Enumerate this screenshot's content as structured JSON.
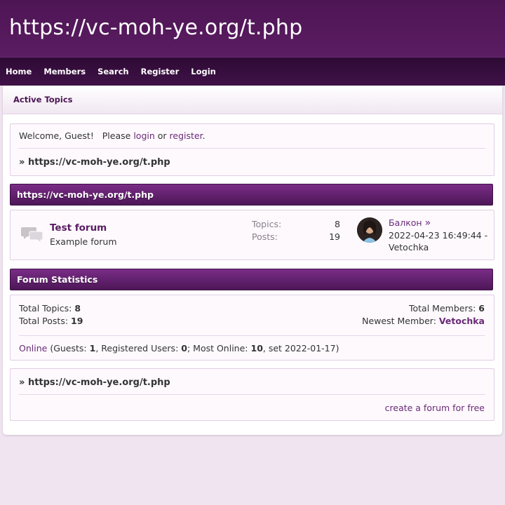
{
  "header": {
    "title": "https://vc-moh-ye.org/t.php"
  },
  "nav": {
    "items": [
      "Home",
      "Members",
      "Search",
      "Register",
      "Login"
    ]
  },
  "subnav": {
    "active_topics": "Active Topics"
  },
  "welcome": {
    "text": "Welcome, Guest!   Please",
    "login": "login",
    "or": "or",
    "register": "register",
    "period": ".",
    "breadcrumb_prefix": "»",
    "breadcrumb": "https://vc-moh-ye.org/t.php"
  },
  "category": {
    "title": "https://vc-moh-ye.org/t.php",
    "forum": {
      "icon": "forum-bubbles-icon",
      "name": "Test forum",
      "description": "Example forum",
      "topics_label": "Topics:",
      "topics": "8",
      "posts_label": "Posts:",
      "posts": "19",
      "last_post": {
        "title": "Балкон",
        "go_arrow": "»",
        "datetime": "2022-04-23 16:49:44 -",
        "author": "Vetochka"
      }
    }
  },
  "stats": {
    "title": "Forum Statistics",
    "total_topics_label": "Total Topics:",
    "total_topics": "8",
    "total_posts_label": "Total Posts:",
    "total_posts": "19",
    "total_members_label": "Total Members:",
    "total_members": "6",
    "newest_member_label": "Newest Member:",
    "newest_member": "Vetochka",
    "online_link": "Online",
    "guests_label": "(Guests:",
    "guests": "1",
    "registered_label": ", Registered Users:",
    "registered": "0",
    "most_online_label": "; Most Online:",
    "most_online": "10",
    "set_text": ", set 2022-01-17)"
  },
  "footer": {
    "breadcrumb_prefix": "»",
    "breadcrumb": "https://vc-moh-ye.org/t.php",
    "create_forum": "create a forum for free"
  },
  "colors": {
    "accent": "#5a1c62",
    "link": "#6a2a78",
    "background": "#efe4f0"
  }
}
